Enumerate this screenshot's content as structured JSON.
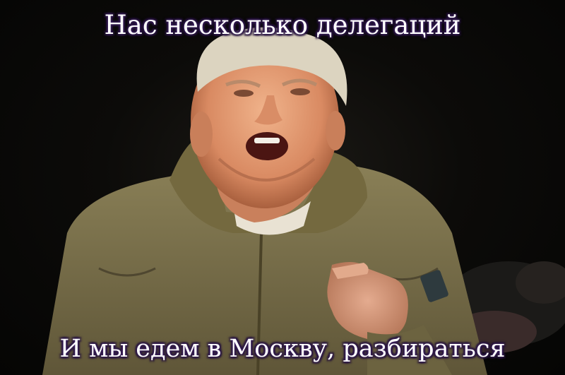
{
  "meme": {
    "top_caption": "Нас несколько делегаций",
    "bottom_caption": "И мы едем в Москву, разбираться"
  },
  "photo": {
    "jacket_color": "#7a7049",
    "skin_color": "#e8a37c",
    "hair_color": "#d9d2bf"
  }
}
